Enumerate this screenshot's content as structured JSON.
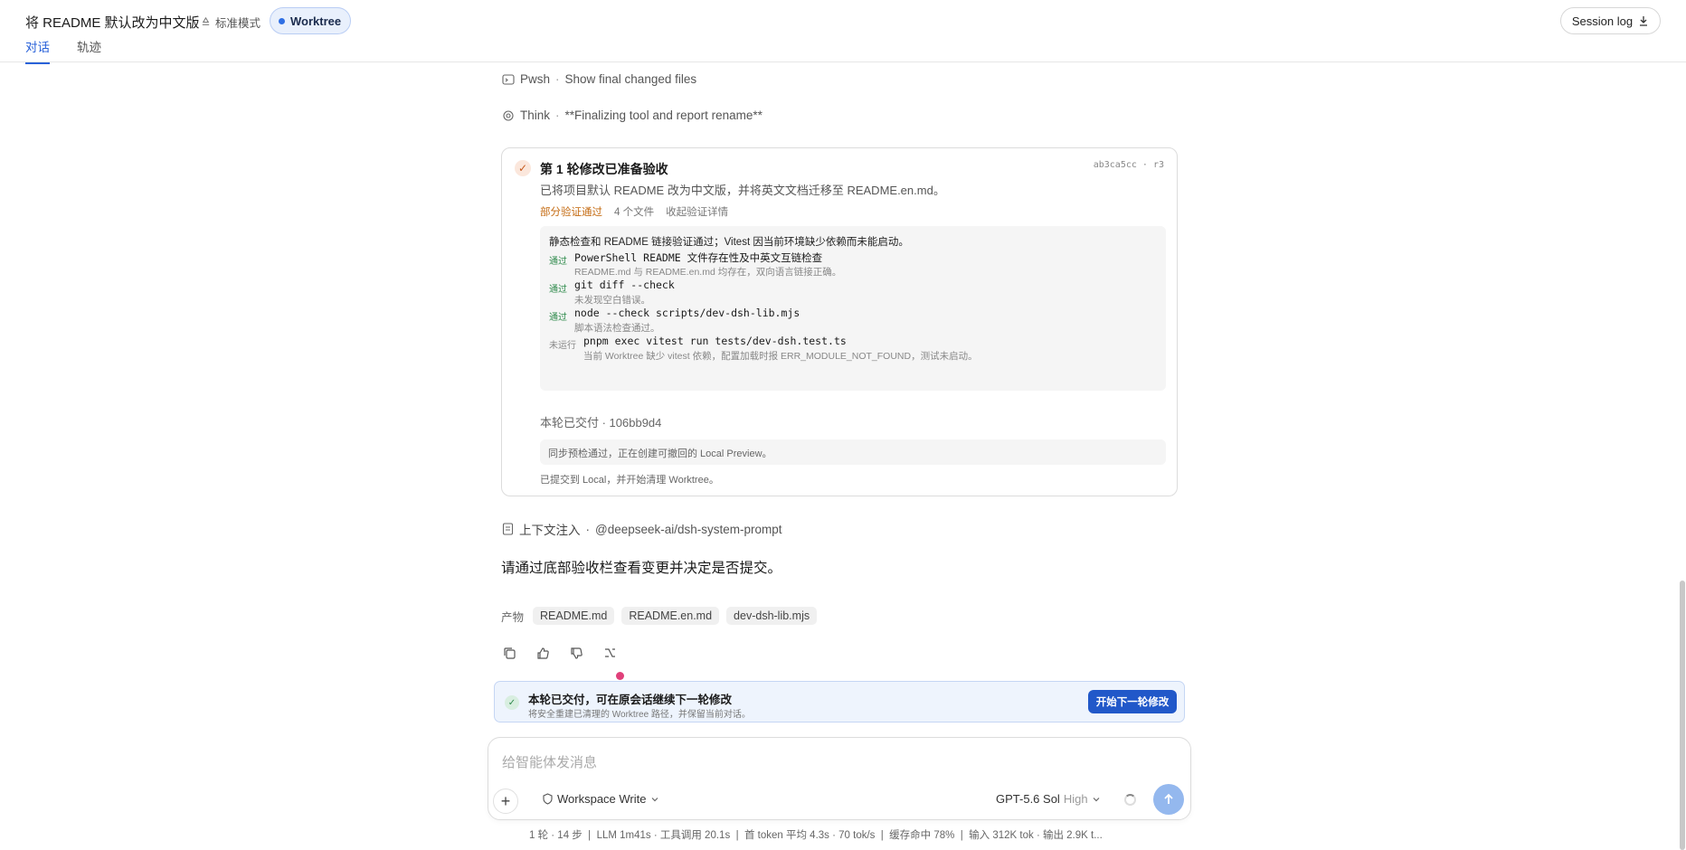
{
  "header": {
    "title": "将 README 默认改为中文版",
    "mode_label": "标准模式",
    "worktree_label": "Worktree",
    "tabs": [
      "对话",
      "轨迹"
    ],
    "session_log_label": "Session log"
  },
  "steps": [
    {
      "tool": "Pwsh",
      "text": "Show final changed files",
      "icon": "terminal-icon"
    },
    {
      "tool": "Think",
      "text": "**Finalizing tool and report rename**",
      "icon": "think-icon"
    }
  ],
  "card": {
    "title": "第 1 轮修改已准备验收",
    "hash": "ab3ca5cc · r3",
    "subtitle": "已将项目默认 README 改为中文版，并将英文文档迁移至 README.en.md。",
    "meta": {
      "partial": "部分验证通过",
      "files": "4 个文件",
      "collapse": "收起验证详情"
    },
    "verify_summary": "静态检查和 README 链接验证通过；Vitest 因当前环境缺少依赖而未能启动。",
    "checks": [
      {
        "status": "通过",
        "command": "PowerShell README 文件存在性及中英文互链检查",
        "note": "README.md 与 README.en.md 均存在，双向语言链接正确。"
      },
      {
        "status": "通过",
        "command": "git diff --check",
        "note": "未发现空白错误。"
      },
      {
        "status": "通过",
        "command": "node --check scripts/dev-dsh-lib.mjs",
        "note": "脚本语法检查通过。"
      },
      {
        "status": "未运行",
        "command": "pnpm exec vitest run tests/dev-dsh.test.ts",
        "note": "当前 Worktree 缺少 vitest 依赖，配置加载时报 ERR_MODULE_NOT_FOUND，测试未启动。"
      }
    ],
    "delivered": "本轮已交付 · 106bb9d4",
    "preview": "同步预检通过，正在创建可撤回的 Local Preview。",
    "committed": "已提交到 Local，并开始清理 Worktree。"
  },
  "context": {
    "label": "上下文注入",
    "value": "@deepseek-ai/dsh-system-prompt"
  },
  "message": "请通过底部验收栏查看变更并决定是否提交。",
  "artifacts": {
    "label": "产物",
    "items": [
      "README.md",
      "README.en.md",
      "dev-dsh-lib.mjs"
    ]
  },
  "banner": {
    "title": "本轮已交付，可在原会话继续下一轮修改",
    "subtitle": "将安全重建已清理的 Worktree 路径，并保留当前对话。",
    "button": "开始下一轮修改"
  },
  "composer": {
    "placeholder": "给智能体发消息",
    "workspace": "Workspace Write",
    "model": "GPT-5.6 Sol",
    "effort": "High"
  },
  "stats": "1 轮 · 14 步  |  LLM 1m41s · 工具调用 20.1s  |  首 token 平均 4.3s · 70 tok/s  |  缓存命中 78%  |  输入 312K tok · 输出 2.9K t...",
  "colors": {
    "accent": "#2a62d9",
    "primary_button": "#2158c9",
    "pass": "#2f8a4c",
    "warn": "#c46a10"
  }
}
